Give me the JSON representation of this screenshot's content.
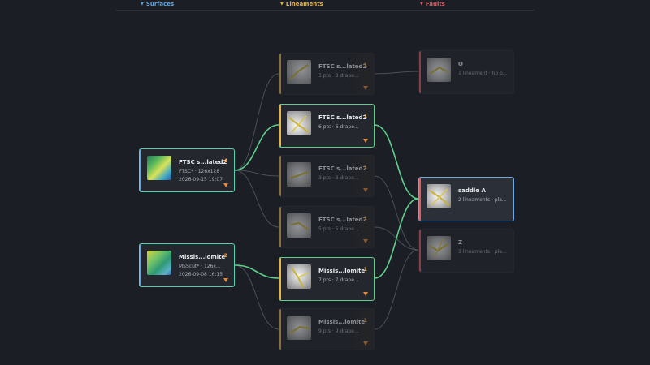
{
  "columns": [
    {
      "label": "Surfaces",
      "color": "#5ea8e0"
    },
    {
      "label": "Lineaments",
      "color": "#e8b341"
    },
    {
      "label": "Faults",
      "color": "#e35a63"
    }
  ],
  "icons": {
    "caret": "triangle-down-icon",
    "expand": "triangle-down-icon"
  },
  "colors": {
    "accent_orange": "#e88a3a",
    "count_orange": "#f0a64a",
    "link_green": "#5fcf8c",
    "selected_blue": "#6aa8e6"
  },
  "surfaces": [
    {
      "title": "FTSC s...lated2",
      "sub": "FTSC* · 126x128",
      "date": "2026-09-15 19:07",
      "count": "4"
    },
    {
      "title": "Missis...lomite",
      "sub": "MSScut* · 126x...",
      "date": "2026-09-08 16:15",
      "count": "2"
    }
  ],
  "lineaments": [
    {
      "title": "FTSC s...lated2",
      "sub": "3 pts · 3 drape...",
      "count": "1"
    },
    {
      "title": "FTSC s...lated2",
      "sub": "6 pts · 6 drape...",
      "count": "1"
    },
    {
      "title": "FTSC s...lated2",
      "sub": "3 pts · 3 drape...",
      "count": "1"
    },
    {
      "title": "FTSC s...lated2",
      "sub": "5 pts · 5 drape...",
      "count": "1"
    },
    {
      "title": "Missis...lomite",
      "sub": "7 pts · 7 drape...",
      "count": "1"
    },
    {
      "title": "Missis...lomite",
      "sub": "9 pts · 9 drape...",
      "count": "1"
    }
  ],
  "faults": [
    {
      "title": "O",
      "sub": "1 lineament · no p..."
    },
    {
      "title": "saddle A",
      "sub": "2 lineaments · pla..."
    },
    {
      "title": "Z",
      "sub": "3 lineaments · pla..."
    }
  ]
}
